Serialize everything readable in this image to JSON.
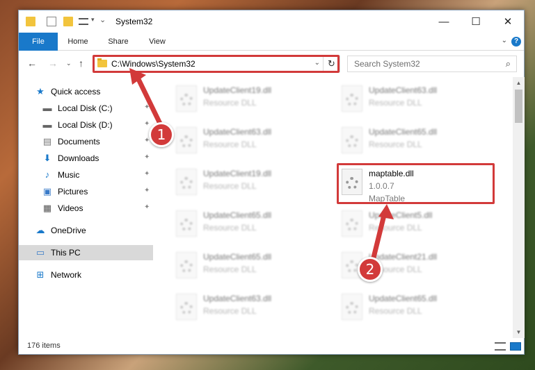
{
  "window": {
    "title": "System32",
    "controls": {
      "minimize": "—",
      "maximize": "☐",
      "close": "✕"
    }
  },
  "ribbon": {
    "tabs": [
      "File",
      "Home",
      "Share",
      "View"
    ],
    "help": "?"
  },
  "address": {
    "path": "C:\\Windows\\System32",
    "search_placeholder": "Search System32"
  },
  "sidebar": {
    "items": [
      {
        "label": "Quick access",
        "icon": "star-icon",
        "pinned": false
      },
      {
        "label": "Local Disk (C:)",
        "icon": "drive-icon",
        "pinned": true
      },
      {
        "label": "Local Disk (D:)",
        "icon": "drive-icon",
        "pinned": true
      },
      {
        "label": "Documents",
        "icon": "documents-icon",
        "pinned": true
      },
      {
        "label": "Downloads",
        "icon": "download-icon",
        "pinned": true
      },
      {
        "label": "Music",
        "icon": "music-icon",
        "pinned": true
      },
      {
        "label": "Pictures",
        "icon": "pictures-icon",
        "pinned": true
      },
      {
        "label": "Videos",
        "icon": "videos-icon",
        "pinned": true
      },
      {
        "label": "OneDrive",
        "icon": "cloud-icon",
        "pinned": false
      },
      {
        "label": "This PC",
        "icon": "computer-icon",
        "pinned": false,
        "selected": true
      },
      {
        "label": "Network",
        "icon": "network-icon",
        "pinned": false
      }
    ]
  },
  "files": [
    {
      "name": "UpdateClient19.dll",
      "line2": "Resource DLL",
      "blurred": true
    },
    {
      "name": "UpdateClient63.dll",
      "line2": "Resource DLL",
      "blurred": true
    },
    {
      "name": "UpdateClient63.dll",
      "line2": "Resource DLL",
      "blurred": true
    },
    {
      "name": "UpdateClient65.dll",
      "line2": "Resource DLL",
      "blurred": true
    },
    {
      "name": "UpdateClient19.dll",
      "line2": "Resource DLL",
      "blurred": true
    },
    {
      "name": "maptable.dll",
      "line2": "1.0.0.7",
      "line3": "MapTable",
      "blurred": false
    },
    {
      "name": "UpdateClient65.dll",
      "line2": "Resource DLL",
      "blurred": true
    },
    {
      "name": "UpdateClient5.dll",
      "line2": "Resource DLL",
      "blurred": true
    },
    {
      "name": "UpdateClient65.dll",
      "line2": "Resource DLL",
      "blurred": true
    },
    {
      "name": "UpdateClient21.dll",
      "line2": "Resource DLL",
      "blurred": true
    },
    {
      "name": "UpdateClient63.dll",
      "line2": "Resource DLL",
      "blurred": true
    },
    {
      "name": "UpdateClient65.dll",
      "line2": "Resource DLL",
      "blurred": true
    }
  ],
  "status": {
    "item_count": "176 items"
  },
  "annotations": {
    "marker1": "1",
    "marker2": "2",
    "color": "#d23a3a"
  },
  "colors": {
    "accent": "#1979ca",
    "folder": "#f2c43d"
  }
}
